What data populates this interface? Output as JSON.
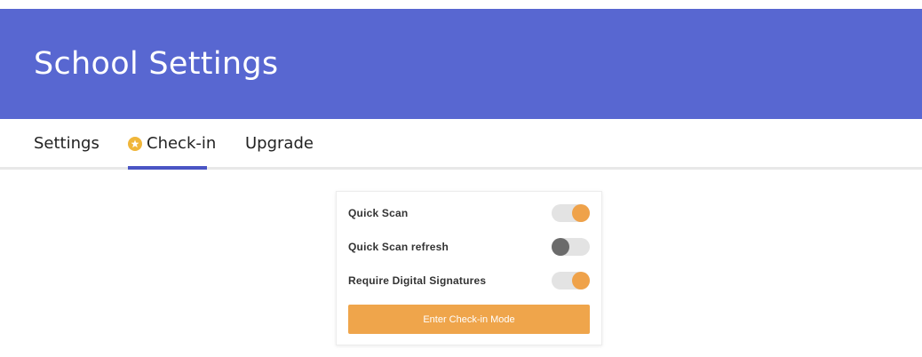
{
  "header": {
    "title": "School Settings",
    "background_color": "#5867d1"
  },
  "tabs": [
    {
      "label": "Settings",
      "active": false
    },
    {
      "label": "Check-in",
      "active": true,
      "icon": "star-icon"
    },
    {
      "label": "Upgrade",
      "active": false
    }
  ],
  "card": {
    "settings": [
      {
        "label": "Quick Scan",
        "enabled": true
      },
      {
        "label": "Quick Scan refresh",
        "enabled": false
      },
      {
        "label": "Require Digital Signatures",
        "enabled": true
      }
    ],
    "action_button_label": "Enter Check-in Mode",
    "accent_color": "#efa54b"
  }
}
